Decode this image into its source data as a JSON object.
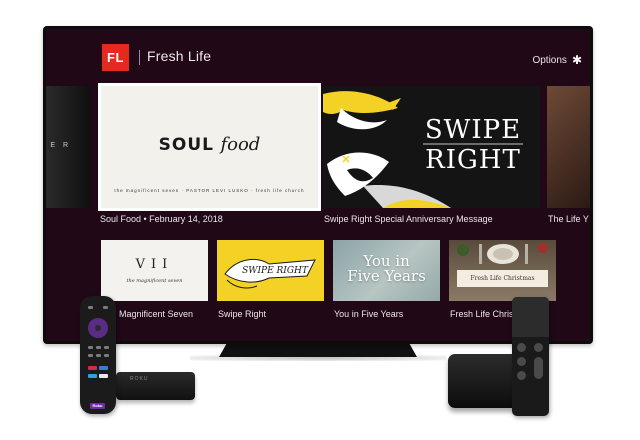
{
  "header": {
    "logo": "FL",
    "title": "Fresh Life",
    "options_label": "Options",
    "options_icon": "asterisk-icon"
  },
  "featured": {
    "partial_left_text": "E R",
    "items": [
      {
        "caption": "Soul Food • February 14, 2018",
        "art_word1": "SOUL",
        "art_word2": "food",
        "art_sub": "the magnificent seven · PASTOR LEVI LUSKO · fresh life church"
      },
      {
        "caption": "Swipe Right Special Anniversary Message",
        "art_line1": "SWIPE",
        "art_line2": "RIGHT"
      },
      {
        "caption": "The Life Y"
      }
    ]
  },
  "row": {
    "items": [
      {
        "caption": "Magnificent Seven",
        "art": "VII",
        "art_sub": "the magnificent seven"
      },
      {
        "caption": "Swipe Right",
        "art": "SWIPE RIGHT"
      },
      {
        "caption": "You in Five Years",
        "art_line1": "You in",
        "art_line2": "Five Years"
      },
      {
        "caption": "Fresh Life Christmas",
        "art": "Fresh Life Christmas"
      }
    ]
  },
  "devices": {
    "roku_tag": "Roku",
    "roku_box_label": "ROKU"
  },
  "colors": {
    "background": "#210816",
    "logo_red": "#e42a1f",
    "swipe_yellow": "#f3d225",
    "roku_purple": "#5b2c86"
  }
}
